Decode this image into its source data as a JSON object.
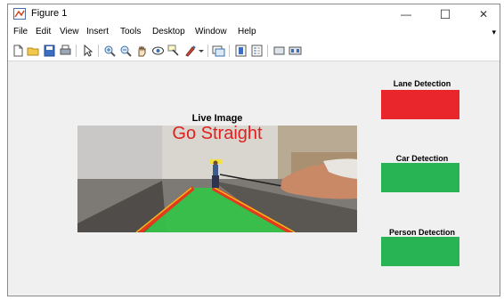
{
  "window": {
    "title": "Figure 1",
    "minimize": "—",
    "maximize": "☐",
    "close": "✕"
  },
  "menu": [
    "File",
    "Edit",
    "View",
    "Insert",
    "Tools",
    "Desktop",
    "Window",
    "Help"
  ],
  "menu_arrow": "▾",
  "toolbar_icons": [
    "new-figure-icon",
    "open-file-icon",
    "save-icon",
    "print-icon",
    "pointer-icon",
    "zoom-in-icon",
    "zoom-out-icon",
    "pan-icon",
    "rotate-3d-icon",
    "data-cursor-icon",
    "brush-icon",
    "brush-dropdown-icon",
    "link-plot-icon",
    "colorbar-icon",
    "legend-icon",
    "hide-plot-tools-icon",
    "show-plot-tools-icon"
  ],
  "plot": {
    "title": "Live Image",
    "overlay_text": "Go Straight",
    "overlay_color": "#e01f1f"
  },
  "panels": {
    "lane": {
      "title": "Lane Detection",
      "color": "#e8262b"
    },
    "car": {
      "title": "Car Detection",
      "color": "#28b455"
    },
    "person": {
      "title": "Person Detection",
      "color": "#28b455"
    }
  }
}
